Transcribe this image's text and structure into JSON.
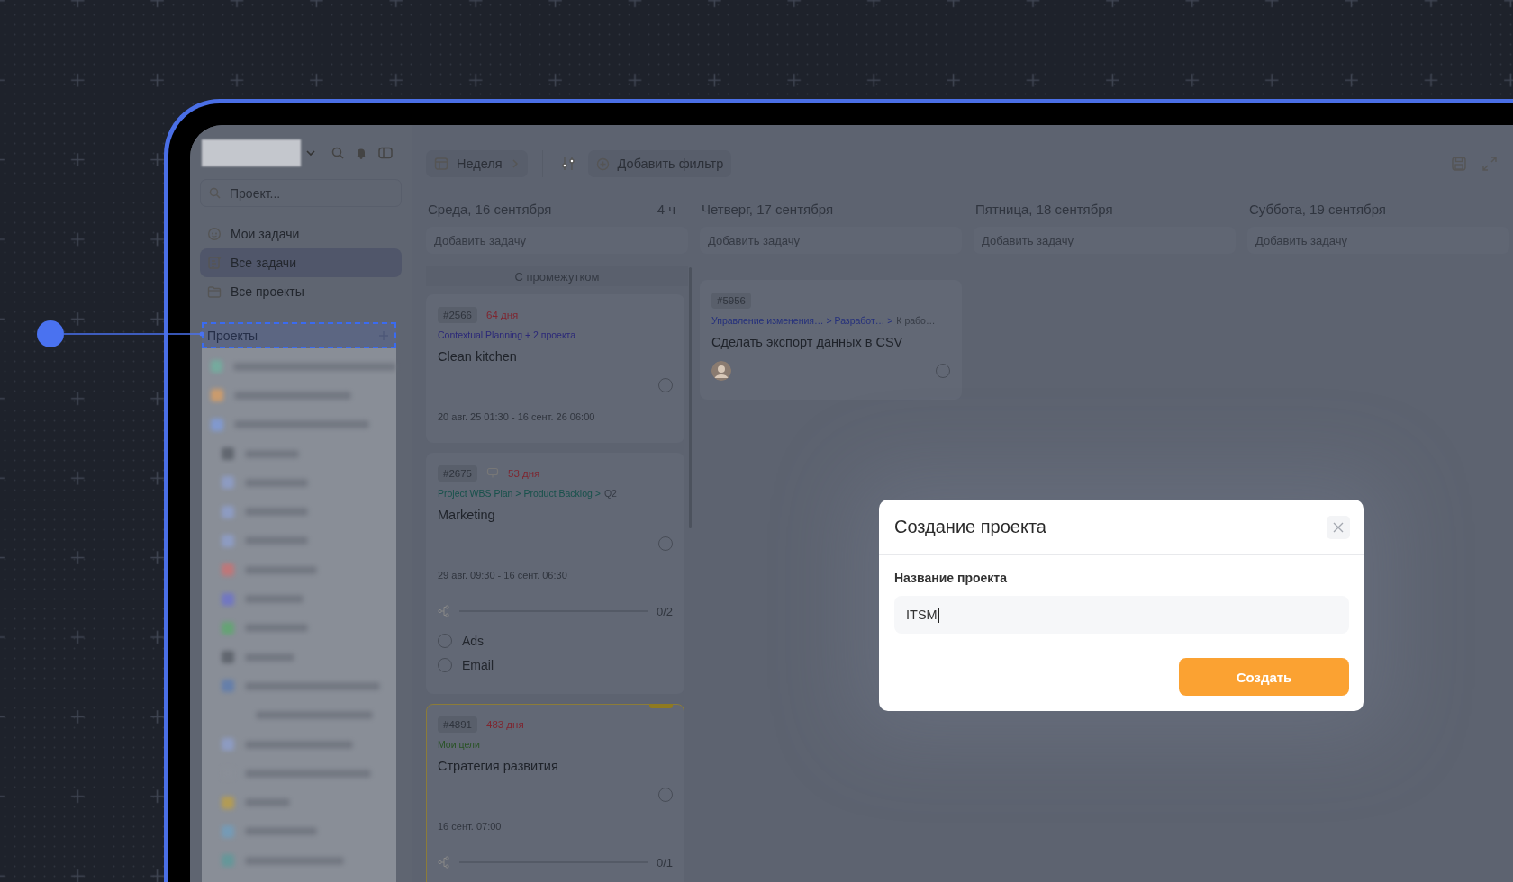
{
  "sidebar": {
    "search": {
      "placeholder": "Проект..."
    },
    "nav": [
      {
        "label": "Мои задачи",
        "selected": false
      },
      {
        "label": "Все задачи",
        "selected": true
      },
      {
        "label": "Все проекты",
        "selected": false
      }
    ],
    "section": {
      "title": "Проекты"
    }
  },
  "toolbar": {
    "view": "Неделя",
    "filter": "Добавить фильтр"
  },
  "columns": [
    {
      "title": "Среда, 16 сентября",
      "hours": "4 ч",
      "add_task": "Добавить задачу",
      "group": "С промежутком",
      "cards": [
        {
          "id": "#2566",
          "comment": false,
          "overdue": "64 дня",
          "color": "#2b2878",
          "path": "Contextual Planning + 2 проекта",
          "title": "Clean kitchen",
          "done": false,
          "avatar": false,
          "highlighted": false,
          "date": "20 авг. 25 01:30 - 16 сент. 26 06:00"
        },
        {
          "id": "#2675",
          "comment": true,
          "overdue": "53 дня",
          "color": "#17514b",
          "path": "Project WBS Plan > Product Backlog >",
          "path_tail": "Q2",
          "title": "Marketing",
          "done": false,
          "avatar": false,
          "highlighted": false,
          "date": "29 авг. 09:30 - 16 сент. 06:30",
          "subtasks": {
            "count": "0/2",
            "level": 0,
            "items": [
              {
                "label": "Ads",
                "checked": false
              },
              {
                "label": "Email",
                "checked": false
              }
            ]
          }
        },
        {
          "id": "#4891",
          "comment": false,
          "overdue": "483 дня",
          "color": "#285224",
          "path": "Мои цели",
          "title": "Стратегия развития",
          "done": false,
          "avatar": false,
          "highlighted": true,
          "date": "16 сент. 07:00",
          "subtasks": {
            "count": "0/1",
            "level": 0
          }
        }
      ]
    },
    {
      "title": "Четверг, 17 сентября",
      "add_task": "Добавить задачу",
      "cards": [
        {
          "id": "#5956",
          "comment": false,
          "color": "#25307c",
          "path": "Управление изменения… > Разработ… >",
          "path_tail": "К рабо…",
          "title": "Сделать экспорт данных в CSV",
          "done": false,
          "avatar": true,
          "highlighted": false
        }
      ]
    },
    {
      "title": "Пятница, 18 сентября",
      "add_task": "Добавить задачу"
    },
    {
      "title": "Суббота, 19 сентября",
      "add_task": "Добавить задачу"
    }
  ],
  "modal": {
    "title": "Создание проекта",
    "field_label": "Название проекта",
    "value": "ITSM",
    "submit": "Создать"
  }
}
